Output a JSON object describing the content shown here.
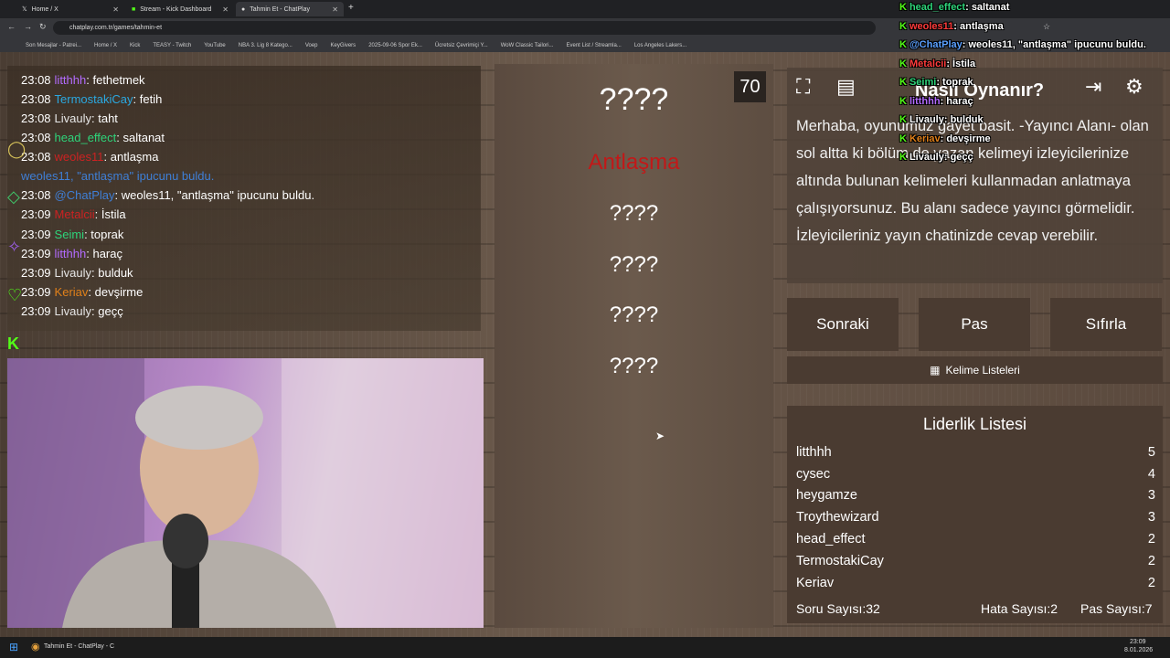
{
  "browser": {
    "tabs": [
      {
        "label": "Home / X"
      },
      {
        "label": "Stream - Kick Dashboard"
      },
      {
        "label": "Tahmin Et - ChatPlay"
      }
    ],
    "url": "chatplay.com.tr/games/tahmin-et",
    "bookmarks": [
      "Son Mesajlar - Patrei...",
      "Home / X",
      "Kick",
      "TEASY - Twitch",
      "YouTube",
      "NBA 3. Lig 8 Katego...",
      "Voep",
      "KeyGivers",
      "2025-09-06 Spor Ek...",
      "Ücretsiz Çevrimiçi Y...",
      "WoW Classic Tailori...",
      "Event List / Streamla...",
      "Los Angeles Lakers..."
    ]
  },
  "chat": {
    "lines": [
      {
        "time": "23:08",
        "user": "litthhh",
        "msg": ": fethetmek",
        "color": "#b36bff"
      },
      {
        "time": "23:08",
        "user": "TermostakiCay",
        "msg": ": fetih",
        "color": "#2aa8e0"
      },
      {
        "time": "23:08",
        "user": "Livauly",
        "msg": ": taht",
        "color": "#e6e6e6"
      },
      {
        "time": "23:08",
        "user": "head_effect",
        "msg": ": saltanat",
        "color": "#2ed47a"
      },
      {
        "time": "23:08",
        "user": "weoles11",
        "msg": ": antlaşma",
        "color": "#cc2222"
      },
      {
        "time": "",
        "user": "weoles11,",
        "msg": " \"antlaşma\" ipucunu buldu.",
        "color": "#3f7fd6"
      },
      {
        "time": "23:08",
        "user": "@ChatPlay",
        "msg": ": weoles11, \"antlaşma\" ipucunu buldu.",
        "color": "#3f7fd6"
      },
      {
        "time": "23:09",
        "user": "Metalcii",
        "msg": ": İstila",
        "color": "#cc2222"
      },
      {
        "time": "23:09",
        "user": "Seimi",
        "msg": ": toprak",
        "color": "#2ed47a"
      },
      {
        "time": "23:09",
        "user": "litthhh",
        "msg": ": haraç",
        "color": "#b36bff"
      },
      {
        "time": "23:09",
        "user": "Livauly",
        "msg": ": bulduk",
        "color": "#e6e6e6"
      },
      {
        "time": "23:09",
        "user": "Keriav",
        "msg": ": devşirme",
        "color": "#e0801a"
      },
      {
        "time": "23:09",
        "user": "Livauly",
        "msg": ": geçç",
        "color": "#e6e6e6"
      }
    ]
  },
  "game": {
    "main_word": "????",
    "revealed_hint": "Antlaşma",
    "hidden_words": [
      "????",
      "????",
      "????",
      "????"
    ],
    "timer": "70"
  },
  "howto": {
    "title": "Nasıl Oynanır?",
    "text": "Merhaba, oyunumuz gayet basit. -Yayıncı Alanı- olan sol altta ki bölüm de yazan kelimeyi izleyicilerinize altında bulunan kelimeleri kullanmadan anlatmaya çalışıyorsunuz. Bu alanı sadece yayıncı görmelidir. İzleyicileriniz yayın chatinizde cevap verebilir."
  },
  "controls": {
    "next": "Sonraki",
    "pass": "Pas",
    "reset": "Sıfırla",
    "word_lists": "Kelime Listeleri"
  },
  "leaderboard": {
    "title": "Liderlik Listesi",
    "rows": [
      {
        "name": "litthhh",
        "score": "5"
      },
      {
        "name": "cysec",
        "score": "4"
      },
      {
        "name": "heygamze",
        "score": "3"
      },
      {
        "name": "Troythewizard",
        "score": "3"
      },
      {
        "name": "head_effect",
        "score": "2"
      },
      {
        "name": "TermostakiCay",
        "score": "2"
      },
      {
        "name": "Keriav",
        "score": "2"
      }
    ],
    "question_count": "Soru Sayısı:32",
    "error_count": "Hata Sayısı:2",
    "pass_count": "Pas Sayısı:7"
  },
  "overlay_chat": [
    {
      "user": "head_effect",
      "msg": ": saltanat",
      "color": "#2ed47a"
    },
    {
      "user": "weoles11",
      "msg": ": antlaşma",
      "color": "#ff3b3b"
    },
    {
      "user": "@ChatPlay",
      "msg": ": weoles11, \"antlaşma\" ipucunu buldu.",
      "color": "#5aa0ff"
    },
    {
      "user": "Metalcii",
      "msg": ": İstila",
      "color": "#ff3b3b"
    },
    {
      "user": "Seimi",
      "msg": ": toprak",
      "color": "#2ed47a"
    },
    {
      "user": "litthhh",
      "msg": ": haraç",
      "color": "#b36bff"
    },
    {
      "user": "Livauly",
      "msg": ": bulduk",
      "color": "#ffffff"
    },
    {
      "user": "Keriav",
      "msg": ": devşirme",
      "color": "#e0801a"
    },
    {
      "user": "Livauly",
      "msg": ": geçç",
      "color": "#ffffff"
    }
  ],
  "taskbar": {
    "app_label": "Tahmin Et - ChatPlay - C",
    "time": "23:09",
    "date": "8.01.2026"
  }
}
